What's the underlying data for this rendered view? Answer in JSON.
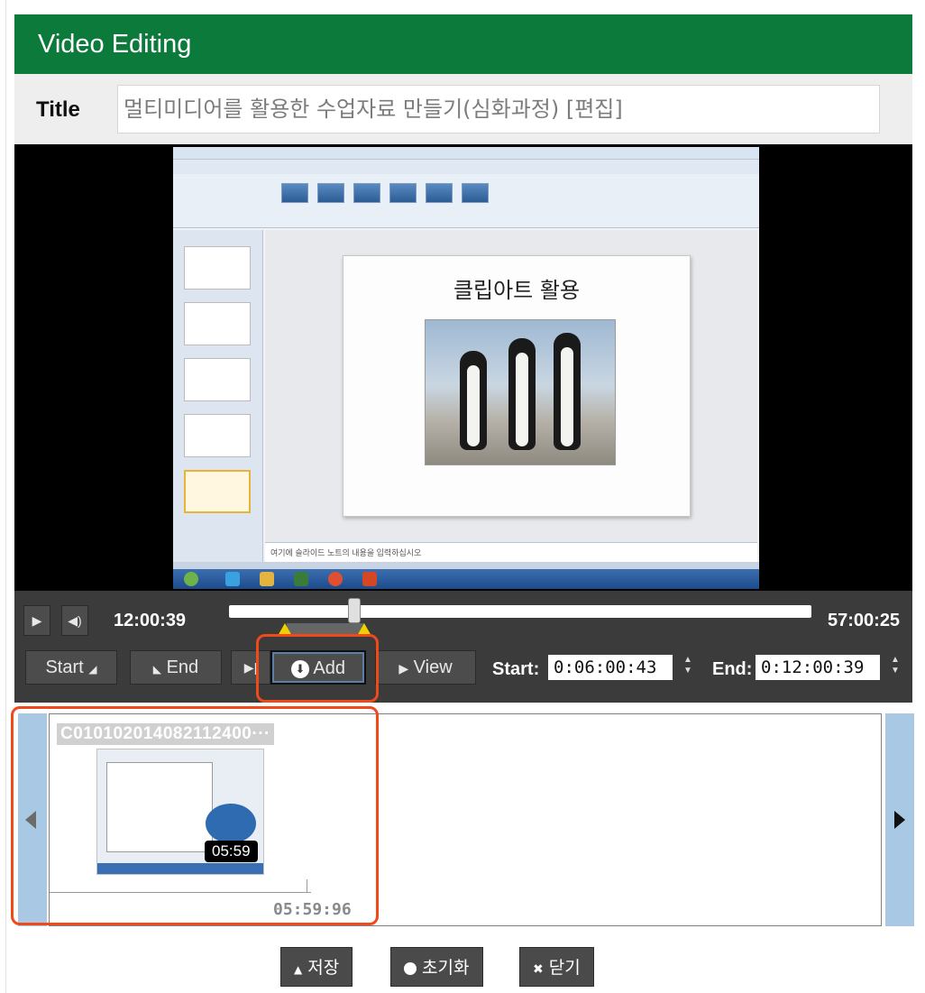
{
  "header": {
    "title": "Video Editing"
  },
  "title_field": {
    "label": "Title",
    "value": "멀티미디어를 활용한 수업자료 만들기(심화과정) [편집]"
  },
  "video": {
    "slide_title": "클립아트 활용",
    "notes_text": "여기에 슬라이드 노트의 내용을 입력하십시오"
  },
  "player": {
    "current_time": "12:00:39",
    "total_time": "57:00:25",
    "play_icon": "play-icon",
    "volume_icon": "volume-icon"
  },
  "edit_controls": {
    "start_label": "Start",
    "end_label": "End",
    "add_label": "Add",
    "view_label": "View",
    "start_field_label": "Start:",
    "start_value": "0:06:00:43",
    "end_field_label": "End:",
    "end_value": "0:12:00:39"
  },
  "clip": {
    "title": "C010102014082112400···",
    "duration": "05:59",
    "timestamp": "05:59:96"
  },
  "footer": {
    "save_label": "저장",
    "reset_label": "초기화",
    "close_label": "닫기"
  },
  "colors": {
    "header_bg": "#0b7a3a",
    "controls_bg": "#3b3b3b",
    "highlight": "#f04a1a",
    "strip_nav": "#a9c8e3",
    "marker": "#f2d000"
  }
}
